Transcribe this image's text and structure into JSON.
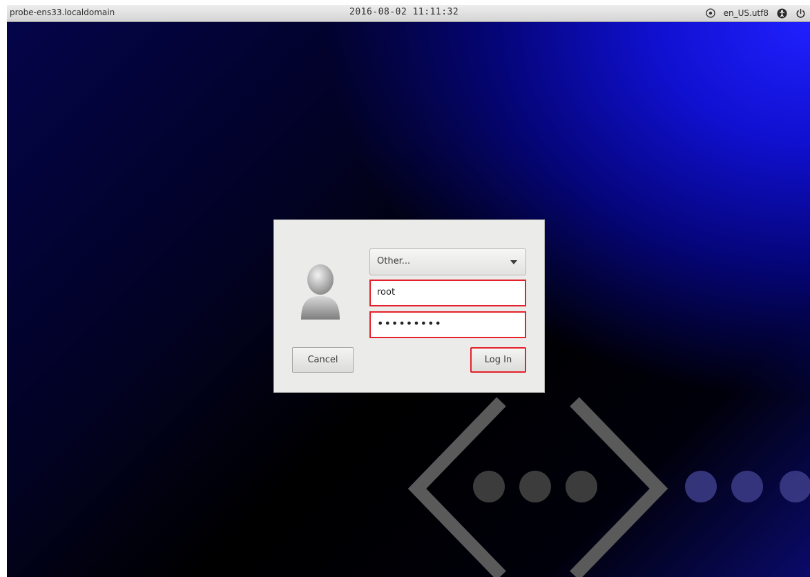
{
  "topbar": {
    "hostname": "probe-ens33.localdomain",
    "datetime": "2016-08-02 11:11:32",
    "locale": "en_US.utf8",
    "icons": [
      "keyboard-icon",
      "accessibility-icon",
      "power-icon"
    ]
  },
  "login_dialog": {
    "user_select": {
      "label": "Other..."
    },
    "username_field": {
      "value": "root"
    },
    "password_field": {
      "value": "•••••••••"
    },
    "cancel_label": "Cancel",
    "login_label": "Log In"
  },
  "colors": {
    "highlight_border": "#e5202a",
    "background_blue": "#2020ff",
    "dialog_bg": "#ebebea"
  }
}
